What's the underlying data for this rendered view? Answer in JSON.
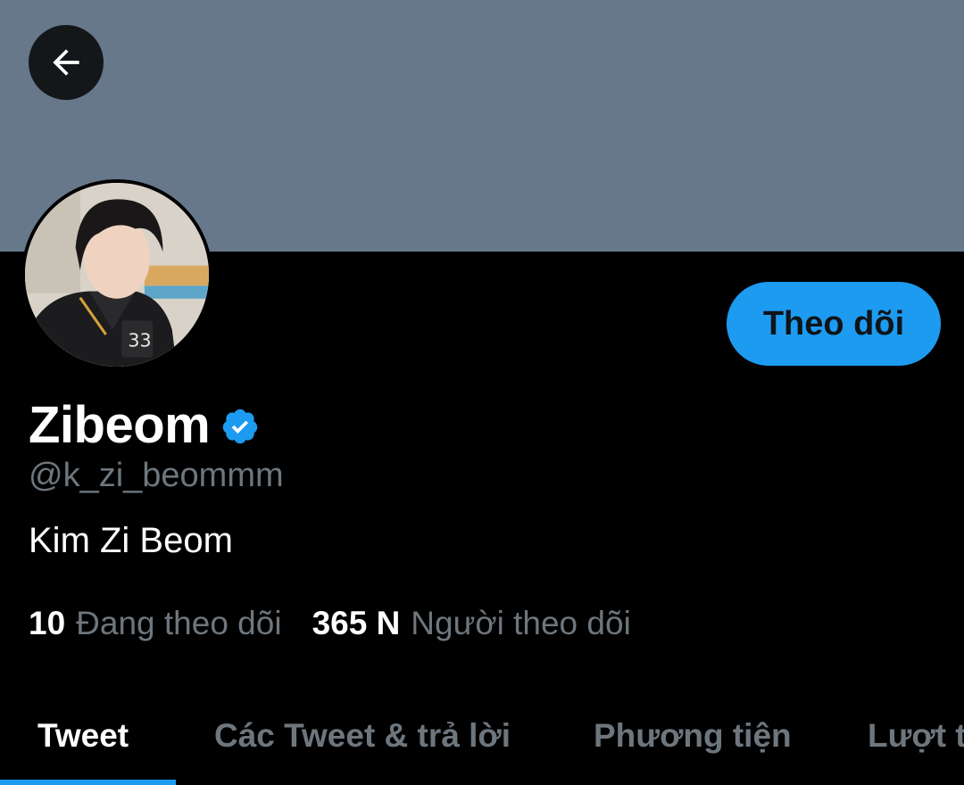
{
  "header": {
    "back_icon": "arrow-left-icon"
  },
  "profile": {
    "avatar_alt": "profile photo",
    "follow_label": "Theo dõi",
    "display_name": "Zibeom",
    "verified_icon": "verified-badge-icon",
    "handle": "@k_zi_beommm",
    "bio": "Kim Zi Beom"
  },
  "stats": {
    "following_count": "10",
    "following_label": "Đang theo dõi",
    "followers_count": "365 N",
    "followers_label": "Người theo dõi"
  },
  "tabs": [
    {
      "label": "Tweet",
      "active": true
    },
    {
      "label": "Các Tweet & trả lời",
      "active": false
    },
    {
      "label": "Phương tiện",
      "active": false
    },
    {
      "label": "Lượt thích",
      "active": false
    }
  ],
  "colors": {
    "banner": "#66788a",
    "background": "#000000",
    "accent": "#1d9bf0",
    "secondary_text": "#6e767d"
  }
}
